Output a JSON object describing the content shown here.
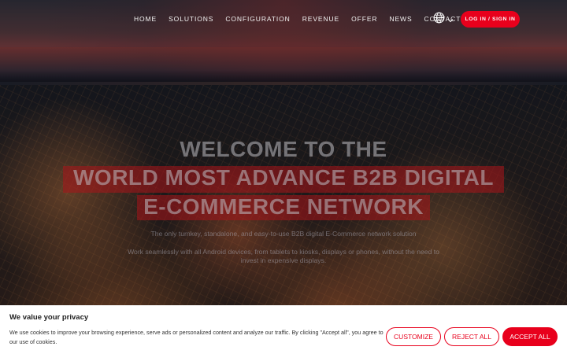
{
  "nav": {
    "items": [
      {
        "label": "HOME"
      },
      {
        "label": "SOLUTIONS"
      },
      {
        "label": "CONFIGURATION"
      },
      {
        "label": "REVENUE"
      },
      {
        "label": "OFFER"
      },
      {
        "label": "NEWS"
      },
      {
        "label": "CONTACT"
      }
    ],
    "language_icon": "globe-icon",
    "login_label": "LOG IN / SIGN IN"
  },
  "hero": {
    "line1": "WELCOME TO THE",
    "line2": "WORLD MOST ADVANCE B2B DIGITAL",
    "line3": "E-COMMERCE NETWORK",
    "subtitle1": "The only turnkey, standalone, and easy-to-use B2B digital E-Commerce network solution",
    "subtitle2": "Work seamlessly with all Android devices, from tablets to kiosks, displays or phones, without the need to invest in expensive displays."
  },
  "cookie": {
    "title": "We value your privacy",
    "text": "We use cookies to improve your browsing experience, serve ads or personalized content and analyze our traffic. By clicking \"Accept all\", you agree to our use of cookies.",
    "customize_label": "CUSTOMIZE",
    "reject_label": "REJECT ALL",
    "accept_label": "ACCEPT ALL"
  },
  "colors": {
    "accent": "#e8001c"
  }
}
